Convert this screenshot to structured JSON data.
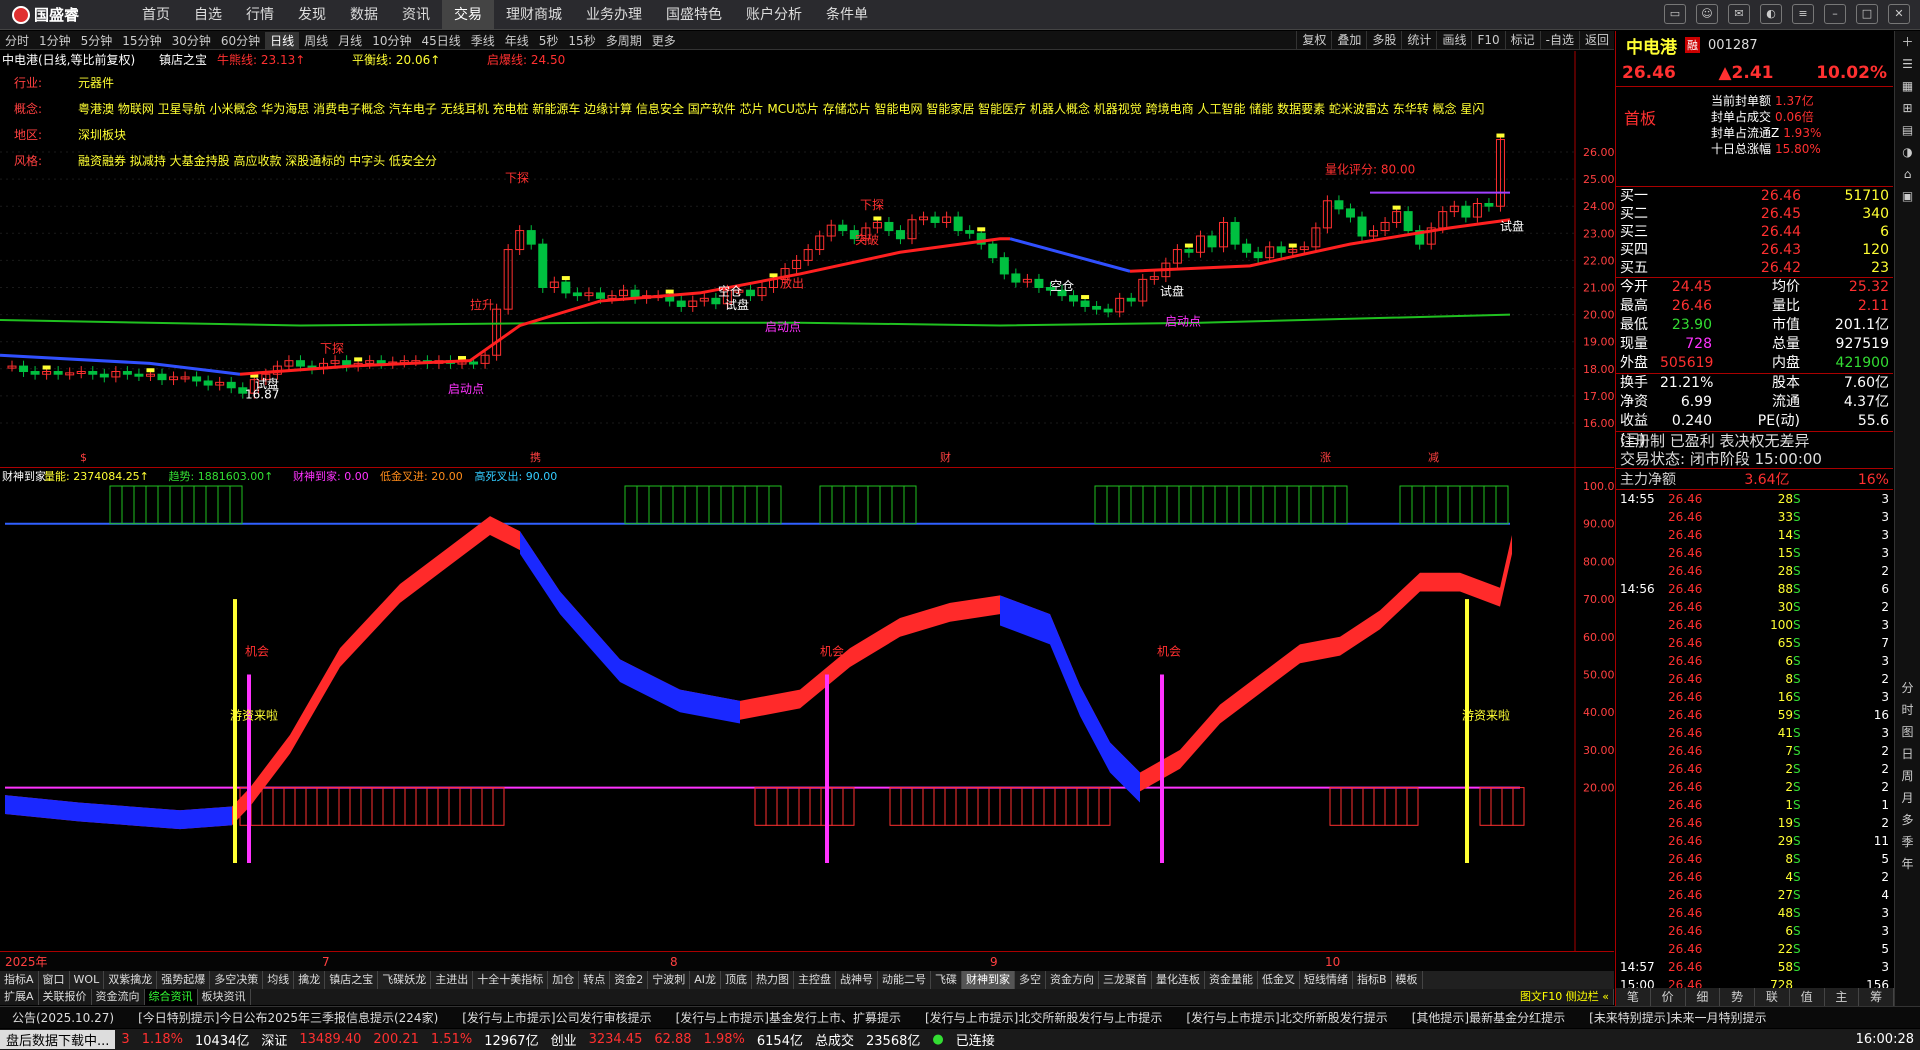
{
  "app": {
    "logo": "国盛睿"
  },
  "nav": [
    "首页",
    "自选",
    "行情",
    "发现",
    "数据",
    "资讯",
    "交易",
    "理财商城",
    "业务办理",
    "国盛特色",
    "账户分析",
    "条件单"
  ],
  "nav_active": 6,
  "periods": [
    "分时",
    "1分钟",
    "5分钟",
    "15分钟",
    "30分钟",
    "60分钟",
    "日线",
    "周线",
    "月线",
    "10分钟",
    "45日线",
    "季线",
    "年线",
    "5秒",
    "15秒",
    "多周期",
    "更多"
  ],
  "period_active": 6,
  "chart_tools": [
    "复权",
    "叠加",
    "多股",
    "统计",
    "画线",
    "F10",
    "标记",
    "-自选",
    "返回"
  ],
  "legend": {
    "name": "中电港(日线,等比前复权)",
    "indicator": "镇店之宝",
    "l1": "牛熊线: 23.13↑",
    "l2": "平衡线: 20.06↑",
    "l3": "启爆线: 24.50"
  },
  "info": [
    {
      "k": "行业:",
      "v": "元器件"
    },
    {
      "k": "概念:",
      "v": "粤港澳 物联网 卫星导航 小米概念 华为海思 消费电子概念 汽车电子 无线耳机 充电桩 新能源车 边缘计算 信息安全 国产软件 芯片 MCU芯片 存储芯片 智能电网 智能家居 智能医疗 机器人概念 机器视觉 跨境电商 人工智能 储能 数据要素 蛇米波雷达 东华转 概念 星闪"
    },
    {
      "k": "地区:",
      "v": "深圳板块"
    },
    {
      "k": "风格:",
      "v": "融资融券 拟减持 大基金持股 高应收款 深股通标的 中字头 低安全分"
    }
  ],
  "yaxis_main": [
    "26.00",
    "25.00",
    "24.00",
    "23.00",
    "22.00",
    "21.00",
    "20.00",
    "19.00",
    "18.00",
    "17.00",
    "16.00"
  ],
  "yaxis_ind": [
    "100.0",
    "90.00",
    "80.00",
    "70.00",
    "60.00",
    "50.00",
    "40.00",
    "30.00",
    "20.00"
  ],
  "ind_legend": {
    "name": "财神到家",
    "a": "量能: 2374084.25↑",
    "b": "趋势: 1881603.00↑",
    "c": "财神到家: 0.00",
    "d": "低金叉进: 20.00",
    "e": "高死叉出: 90.00"
  },
  "annotations": {
    "xiacha": "下探",
    "tuisheng": "拉升",
    "shipan": "试盘",
    "kongcang": "空仓",
    "qidong": "启动点",
    "jihui": "机会",
    "youzi": "游资来啦",
    "tupo": "突破",
    "kaichu": "放出",
    "low": "16.87",
    "rating": "量化评分: 80.00"
  },
  "xaxis": [
    "2025年",
    "7",
    "8",
    "9",
    "10"
  ],
  "xmarks": [
    "$",
    "携",
    "财",
    "涨",
    "减"
  ],
  "indtabs": [
    "指标A",
    "窗口",
    "WOL",
    "双紫擒龙",
    "强势起爆",
    "多空决策",
    "均线",
    "擒龙",
    "镇店之宝",
    "飞碟妖龙",
    "主进出",
    "十全十美指标",
    "加仓",
    "转点",
    "资金2",
    "宁波刺",
    "AI龙",
    "顶底",
    "热力图",
    "主控盘",
    "战神号",
    "动能二号",
    "飞碟",
    "财神到家",
    "多空",
    "资金方向",
    "三龙聚首",
    "量化连板",
    "资金量能",
    "低金叉",
    "短线情绪"
  ],
  "indtab_right": [
    "指标B",
    "模板"
  ],
  "maintabs": [
    "扩展A",
    "关联报价",
    "资金流向",
    "综合资讯",
    "板块资讯"
  ],
  "maintabs_right": "图文F10 侧边栏 «",
  "news": [
    "公告(2025.10.27)",
    "[今日特别提示]今日公布2025年三季报信息提示(224家)",
    "[发行与上市提示]公司发行审核提示",
    "[发行与上市提示]基金发行上市、扩募提示",
    "[发行与上市提示]北交所新股发行与上市提示",
    "[发行与上市提示]北交所新股发行提示",
    "[其他提示]最新基金分红提示",
    "[未来特别提示]未来一月特别提示"
  ],
  "status": {
    "downloading": "盘后数据下载中...",
    "a": "3",
    "b": "1.18%",
    "c": "10434亿",
    "d": "深证",
    "e": "13489.40",
    "f": "200.21",
    "g": "1.51%",
    "h": "12967亿",
    "i": "创业",
    "j": "3234.45",
    "k": "62.88",
    "l": "1.98%",
    "m": "6154亿",
    "n": "总成交",
    "o": "23568亿",
    "p": "已连接",
    "time": "16:00:28"
  },
  "right": {
    "name": "中电港",
    "tag": "融",
    "code": "001287",
    "price": "26.46",
    "change": "▲2.41",
    "pct": "10.02%",
    "board": "首板",
    "board_kv": [
      [
        "当前封单额",
        "1.37亿"
      ],
      [
        "封单占成交",
        "0.06倍"
      ],
      [
        "封单占流通Z",
        "1.93%"
      ],
      [
        "十日总涨幅",
        "15.80%"
      ]
    ],
    "orderbook": [
      [
        "买一",
        "26.46",
        "51710"
      ],
      [
        "买二",
        "26.45",
        "340"
      ],
      [
        "买三",
        "26.44",
        "6"
      ],
      [
        "买四",
        "26.43",
        "120"
      ],
      [
        "买五",
        "26.42",
        "23"
      ]
    ],
    "quote": [
      [
        "今开",
        "24.45",
        "均价",
        "25.32"
      ],
      [
        "最高",
        "26.46",
        "量比",
        "2.11"
      ],
      [
        "最低",
        "23.90",
        "市值",
        "201.1亿"
      ],
      [
        "现量",
        "728",
        "总量",
        "927519"
      ],
      [
        "外盘",
        "505619",
        "内盘",
        "421900"
      ]
    ],
    "quote2": [
      [
        "换手",
        "21.21%",
        "股本",
        "7.60亿"
      ],
      [
        "净资",
        "6.99",
        "流通",
        "4.37亿"
      ],
      [
        "收益(三)",
        "0.240",
        "PE(动)",
        "55.6"
      ]
    ],
    "info": [
      "注册制 已盈利 表决权无差异",
      "交易状态: 闭市阶段 15:00:00"
    ],
    "flow": {
      "label": "主力净额",
      "value": "3.64亿",
      "pct": "16%"
    },
    "ticks": [
      [
        "14:55",
        "26.46",
        "28",
        "S",
        "3"
      ],
      [
        "",
        "26.46",
        "33",
        "S",
        "3"
      ],
      [
        "",
        "26.46",
        "14",
        "S",
        "3"
      ],
      [
        "",
        "26.46",
        "15",
        "S",
        "3"
      ],
      [
        "",
        "26.46",
        "28",
        "S",
        "2"
      ],
      [
        "14:56",
        "26.46",
        "88",
        "S",
        "6"
      ],
      [
        "",
        "26.46",
        "30",
        "S",
        "2"
      ],
      [
        "",
        "26.46",
        "100",
        "S",
        "3"
      ],
      [
        "",
        "26.46",
        "65",
        "S",
        "7"
      ],
      [
        "",
        "26.46",
        "6",
        "S",
        "3"
      ],
      [
        "",
        "26.46",
        "8",
        "S",
        "2"
      ],
      [
        "",
        "26.46",
        "16",
        "S",
        "3"
      ],
      [
        "",
        "26.46",
        "59",
        "S",
        "16"
      ],
      [
        "",
        "26.46",
        "41",
        "S",
        "3"
      ],
      [
        "",
        "26.46",
        "7",
        "S",
        "2"
      ],
      [
        "",
        "26.46",
        "2",
        "S",
        "2"
      ],
      [
        "",
        "26.46",
        "2",
        "S",
        "2"
      ],
      [
        "",
        "26.46",
        "1",
        "S",
        "1"
      ],
      [
        "",
        "26.46",
        "19",
        "S",
        "2"
      ],
      [
        "",
        "26.46",
        "29",
        "S",
        "11"
      ],
      [
        "",
        "26.46",
        "8",
        "S",
        "5"
      ],
      [
        "",
        "26.46",
        "4",
        "S",
        "2"
      ],
      [
        "",
        "26.46",
        "27",
        "S",
        "4"
      ],
      [
        "",
        "26.46",
        "48",
        "S",
        "3"
      ],
      [
        "",
        "26.46",
        "6",
        "S",
        "3"
      ],
      [
        "",
        "26.46",
        "22",
        "S",
        "5"
      ],
      [
        "14:57",
        "26.46",
        "58",
        "S",
        "3"
      ],
      [
        "15:00",
        "26.46",
        "728",
        "",
        "156"
      ]
    ],
    "bottom_tabs": [
      "笔",
      "价",
      "细",
      "势",
      "联",
      "值",
      "主",
      "筹"
    ]
  },
  "side": [
    "分",
    "时",
    "图",
    "日",
    "周",
    "月",
    "多",
    "季",
    "年"
  ]
}
